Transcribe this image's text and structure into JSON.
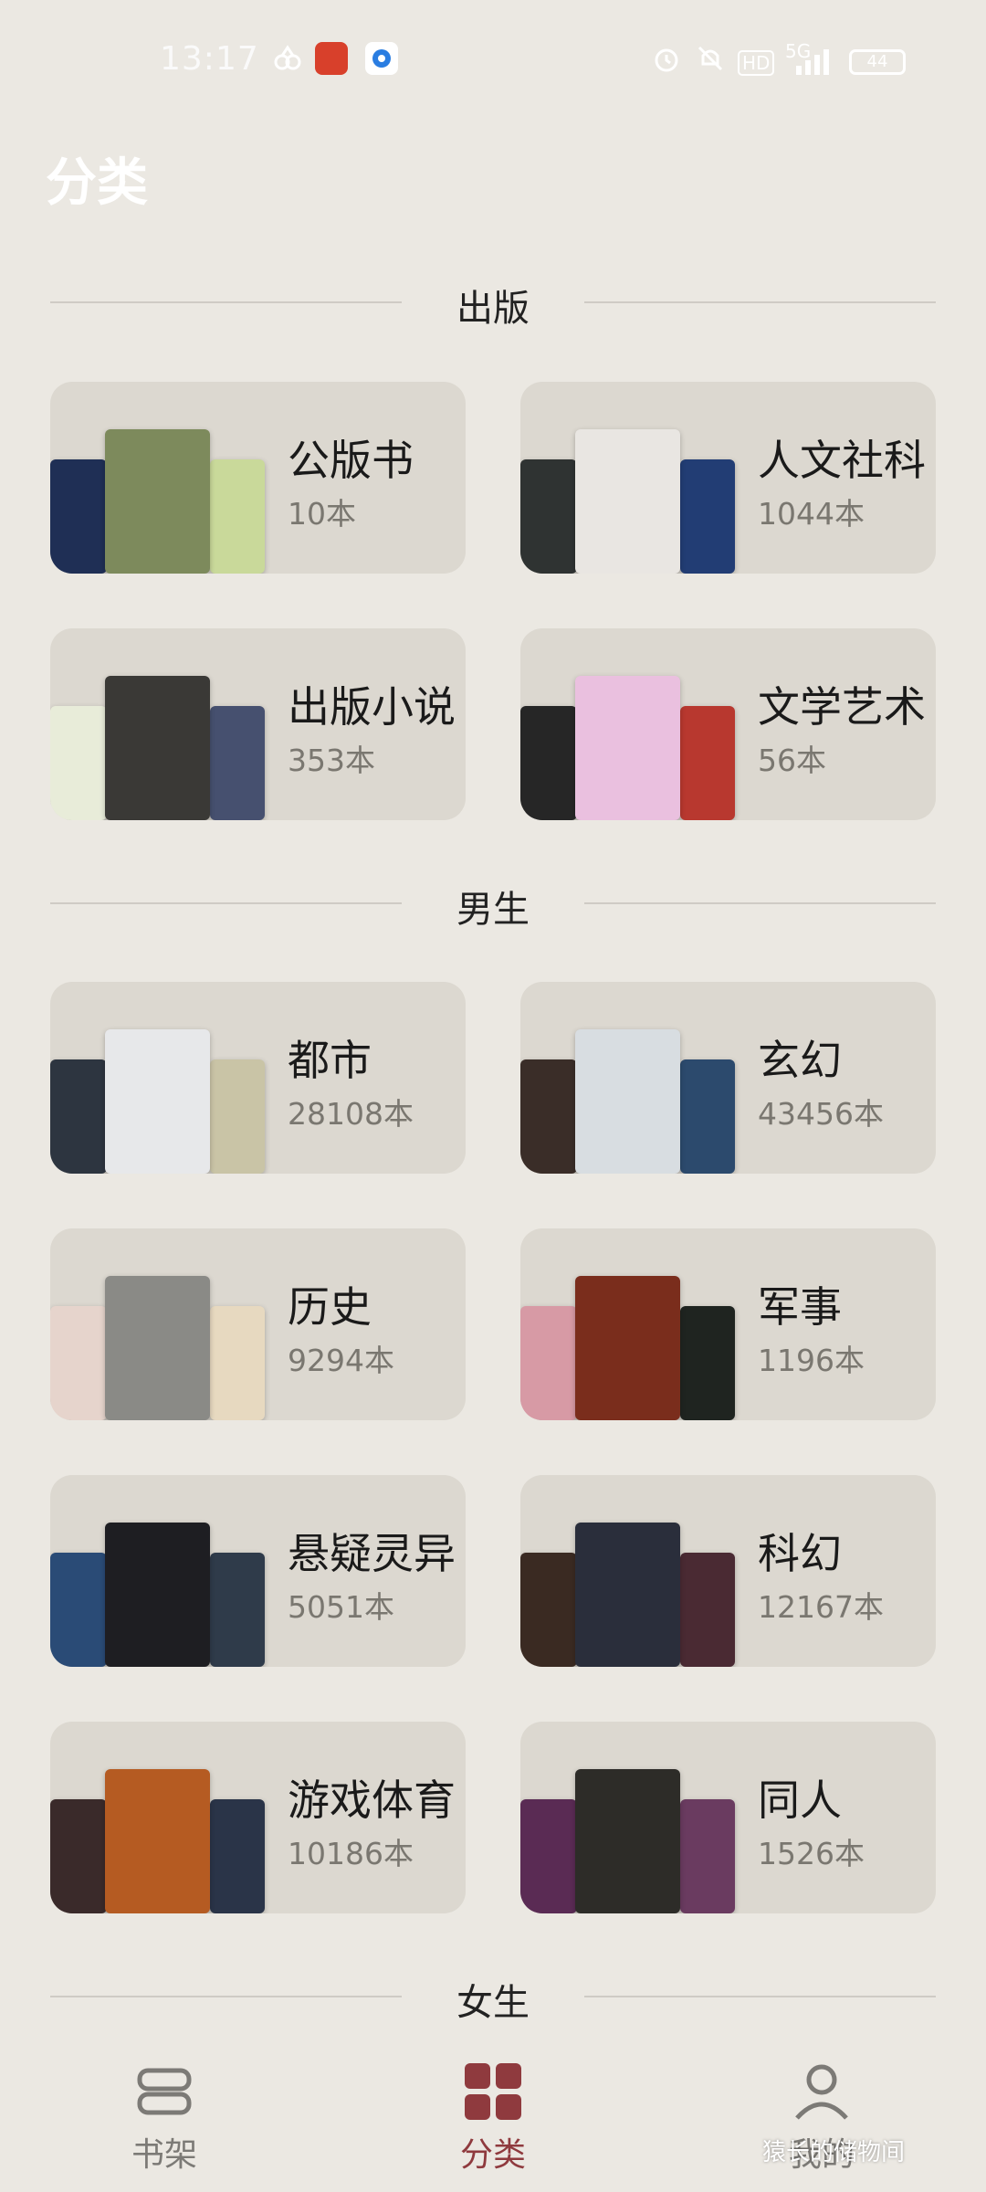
{
  "status_bar": {
    "time": "13:17",
    "network": "5G",
    "hd": "HD",
    "battery": "44"
  },
  "page": {
    "title": "分类"
  },
  "sections": [
    {
      "label": "出版",
      "cards": [
        {
          "name": "公版书",
          "count": "10本",
          "covers": [
            "#1f2f55",
            "#7d8a5c",
            "#c9d99a"
          ]
        },
        {
          "name": "人文社科",
          "count": "1044本",
          "covers": [
            "#2f3332",
            "#e9e6e2",
            "#223d74"
          ]
        },
        {
          "name": "出版小说",
          "count": "353本",
          "covers": [
            "#e8ecd9",
            "#3a3936",
            "#46506f"
          ]
        },
        {
          "name": "文学艺术",
          "count": "56本",
          "covers": [
            "#262626",
            "#eac0df",
            "#b8382f"
          ]
        }
      ]
    },
    {
      "label": "男生",
      "cards": [
        {
          "name": "都市",
          "count": "28108本",
          "covers": [
            "#2d3540",
            "#e7e8ea",
            "#c9c4a6"
          ]
        },
        {
          "name": "玄幻",
          "count": "43456本",
          "covers": [
            "#3a2d28",
            "#d8dde1",
            "#2c4a6d"
          ]
        },
        {
          "name": "历史",
          "count": "9294本",
          "covers": [
            "#e6d4cc",
            "#8a8a86",
            "#e7d9c0"
          ]
        },
        {
          "name": "军事",
          "count": "1196本",
          "covers": [
            "#d79aa5",
            "#7a2d1c",
            "#1f2420"
          ]
        },
        {
          "name": "悬疑灵异",
          "count": "5051本",
          "covers": [
            "#2a4b76",
            "#1e1e22",
            "#2f3b4a"
          ]
        },
        {
          "name": "科幻",
          "count": "12167本",
          "covers": [
            "#3a2a22",
            "#2a2e3b",
            "#4a2a33"
          ]
        },
        {
          "name": "游戏体育",
          "count": "10186本",
          "covers": [
            "#3a2a2a",
            "#b55b22",
            "#2a3448"
          ]
        },
        {
          "name": "同人",
          "count": "1526本",
          "covers": [
            "#5a2b54",
            "#2d2c28",
            "#6a3b60"
          ]
        }
      ]
    },
    {
      "label": "女生"
    }
  ],
  "nav": {
    "items": [
      {
        "label": "书架",
        "icon": "bookshelf-icon"
      },
      {
        "label": "分类",
        "icon": "category-grid-icon",
        "active": true
      },
      {
        "label": "我的",
        "icon": "profile-icon"
      }
    ]
  },
  "watermark": "猿长的储物间",
  "colors": {
    "accent": "#8f3a3e",
    "background": "#ebe8e2",
    "card": "#dcd8d0"
  }
}
